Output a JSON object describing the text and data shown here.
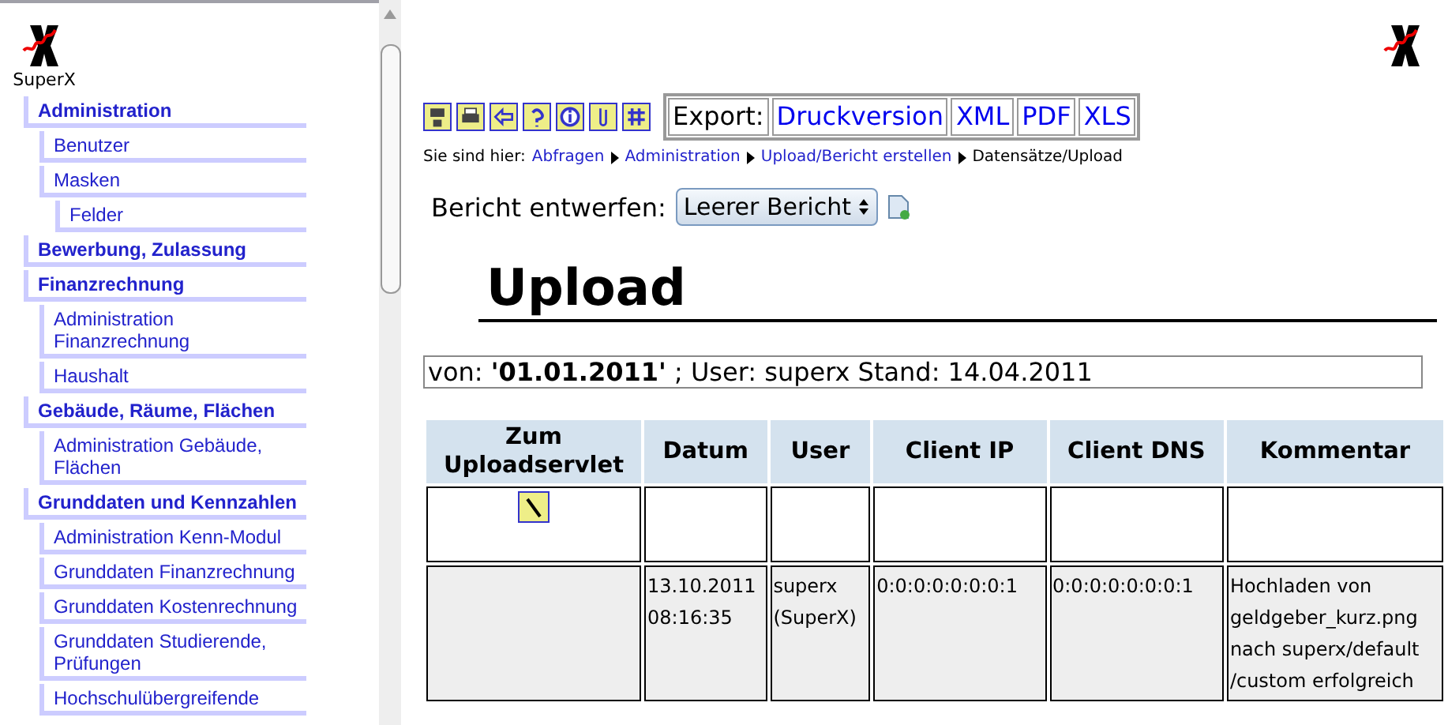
{
  "sidebar": {
    "logo_caption": "SuperX",
    "items": [
      {
        "label": "Administration",
        "children": [
          {
            "label": "Benutzer"
          },
          {
            "label": "Masken",
            "children": [
              {
                "label": "Felder"
              }
            ]
          }
        ]
      },
      {
        "label": "Bewerbung, Zulassung"
      },
      {
        "label": "Finanzrechnung",
        "children": [
          {
            "label": "Administration Finanzrechnung"
          },
          {
            "label": "Haushalt"
          }
        ]
      },
      {
        "label": "Gebäude, Räume, Flächen",
        "children": [
          {
            "label": "Administration Gebäude, Flächen"
          }
        ]
      },
      {
        "label": "Grunddaten und Kennzahlen",
        "children": [
          {
            "label": "Administration Kenn-Modul"
          },
          {
            "label": "Grunddaten Finanzrechnung"
          },
          {
            "label": "Grunddaten Kostenrechnung"
          },
          {
            "label": "Grunddaten Studierende, Prüfungen"
          },
          {
            "label": "Hochschulübergreifende"
          }
        ]
      }
    ]
  },
  "toolbar": {
    "export_label": "Export:",
    "export_links": [
      "Druckversion",
      "XML",
      "PDF",
      "XLS"
    ]
  },
  "breadcrumb": {
    "prefix": "Sie sind hier:",
    "links": [
      "Abfragen",
      "Administration",
      "Upload/Bericht erstellen"
    ],
    "current": "Datensätze/Upload"
  },
  "report_design": {
    "label": "Bericht entwerfen:",
    "value": "Leerer Bericht"
  },
  "title": "Upload",
  "params": "von:  **'01.01.2011'** ; User: superx  Stand: 14.04.2011",
  "table": {
    "columns": [
      "Zum Uploadservlet",
      "Datum",
      "User",
      "Client IP",
      "Client DNS",
      "Kommentar"
    ],
    "rows": [
      {
        "kind": "link",
        "cells": [
          "",
          "",
          "",
          "",
          "",
          ""
        ]
      },
      {
        "kind": "data",
        "cells": [
          "",
          "13.10.2011 08:16:35",
          "superx (SuperX)",
          "0:0:0:0:0:0:0:1",
          "0:0:0:0:0:0:0:1",
          "Hochladen von geldgeber_kurz.png nach superx/default /custom erfolgreich"
        ]
      }
    ]
  }
}
